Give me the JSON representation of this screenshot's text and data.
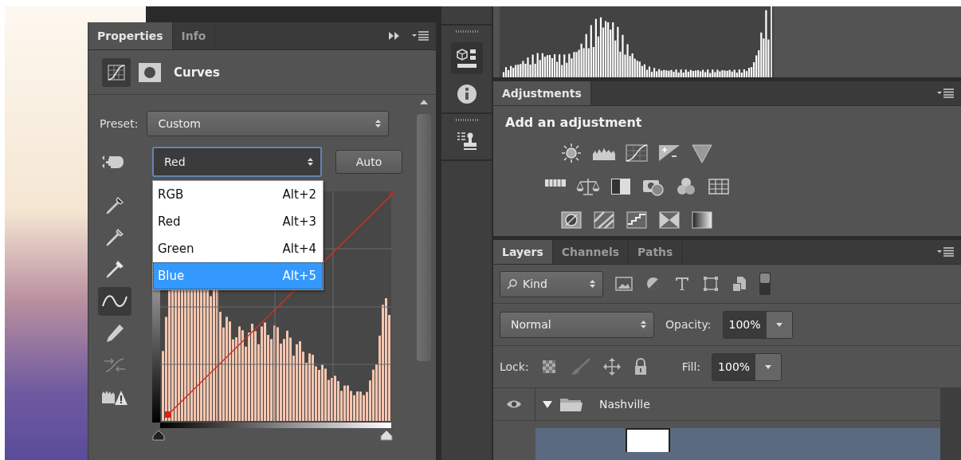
{
  "properties_panel": {
    "tabs": [
      {
        "label": "Properties",
        "selected": true
      },
      {
        "label": "Info",
        "selected": false
      }
    ],
    "title": "Curves",
    "preset": {
      "label": "Preset:",
      "value": "Custom"
    },
    "channel": {
      "value": "Red"
    },
    "auto_button": "Auto",
    "input_sliders": [
      {
        "level": 0
      },
      {
        "level": 1
      }
    ],
    "channel_menu": [
      {
        "label": "RGB",
        "shortcut": "Alt+2",
        "selected": false
      },
      {
        "label": "Red",
        "shortcut": "Alt+3",
        "selected": false
      },
      {
        "label": "Green",
        "shortcut": "Alt+4",
        "selected": false
      },
      {
        "label": "Blue",
        "shortcut": "Alt+5",
        "selected": true
      }
    ],
    "tools": [
      {
        "kind": "eyedropper",
        "selected": false
      },
      {
        "kind": "eyedropper",
        "selected": false
      },
      {
        "kind": "eyedropper",
        "selected": false
      },
      {
        "kind": "curve",
        "selected": true
      },
      {
        "kind": "pencil",
        "selected": false
      },
      {
        "kind": "smooth",
        "selected": false
      },
      {
        "kind": "clipping",
        "selected": false
      }
    ]
  },
  "adjustments_panel": {
    "tab": "Adjustments",
    "heading": "Add an adjustment"
  },
  "layers_panel": {
    "tabs": [
      {
        "label": "Layers",
        "selected": true
      },
      {
        "label": "Channels",
        "selected": false
      },
      {
        "label": "Paths",
        "selected": false
      }
    ],
    "filter": "Kind",
    "filter_enabled": true,
    "blend_mode": "Normal",
    "opacity": {
      "label": "Opacity:",
      "value": "100%"
    },
    "lock_label": "Lock:",
    "fill": {
      "label": "Fill:",
      "value": "100%"
    },
    "layers": [
      {
        "name": "Nashville",
        "visible": true,
        "expanded": true,
        "children": [
          {
            "selected": true
          }
        ]
      }
    ]
  }
}
